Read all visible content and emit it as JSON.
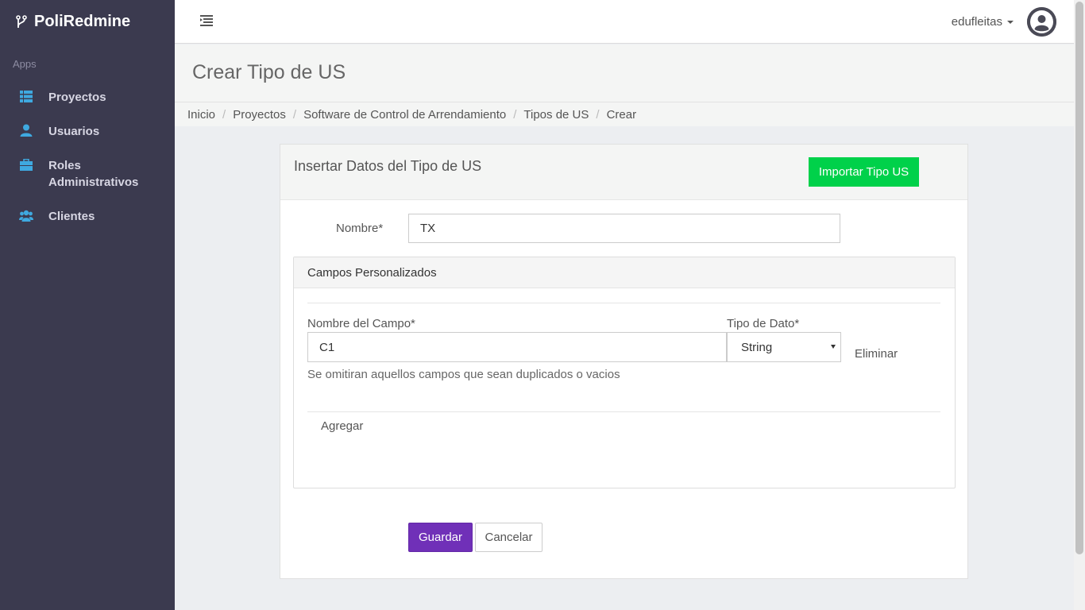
{
  "app": {
    "brand": "PoliRedmine",
    "apps_label": "Apps"
  },
  "sidebar": {
    "items": [
      {
        "label": "Proyectos",
        "icon": "list-icon"
      },
      {
        "label": "Usuarios",
        "icon": "user-icon"
      },
      {
        "label": "Roles Administrativos",
        "icon": "briefcase-icon"
      },
      {
        "label": "Clientes",
        "icon": "users-icon"
      }
    ]
  },
  "topbar": {
    "username": "edufleitas"
  },
  "page": {
    "title": "Crear Tipo de US",
    "breadcrumb": [
      "Inicio",
      "Proyectos",
      "Software de Control de Arrendamiento",
      "Tipos de US",
      "Crear"
    ]
  },
  "form": {
    "card_title": "Insertar Datos del Tipo de US",
    "import_label": "Importar Tipo US",
    "nombre_label": "Nombre*",
    "nombre_value": "TX",
    "panel_title": "Campos Personalizados",
    "campo_label": "Nombre del Campo*",
    "campo_value": "C1",
    "tipo_label": "Tipo de Dato*",
    "tipo_value": "String",
    "eliminar_label": "Eliminar",
    "help_text": "Se omitiran aquellos campos que sean duplicados o vacios",
    "agregar_label": "Agregar",
    "guardar_label": "Guardar",
    "cancelar_label": "Cancelar"
  },
  "colors": {
    "sidebar_bg": "#3b3a4f",
    "accent_icon": "#3fa9e0",
    "import_button": "#00d14a",
    "save_button": "#7030b8"
  }
}
